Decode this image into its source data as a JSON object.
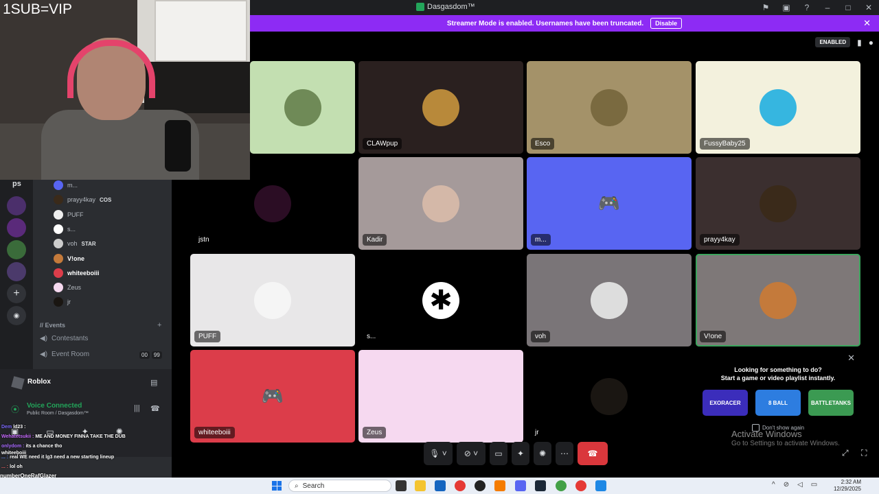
{
  "window": {
    "title": "Dasgasdom™"
  },
  "streamer": {
    "message": "Streamer Mode is enabled. Usernames have been truncated.",
    "disable_label": "Disable"
  },
  "call": {
    "enabled_badge": "ENABLED",
    "tiles": [
      {
        "name": "",
        "bg": "#c3dfb1",
        "avatar": "#6f8a57"
      },
      {
        "name": "CLAWpup",
        "bg": "#2a201f",
        "avatar": "#b8893a"
      },
      {
        "name": "Esco",
        "bg": "#a49269",
        "avatar": "#7a6a40"
      },
      {
        "name": "FussyBaby25",
        "bg": "#f3f1dd",
        "avatar": "#36b6e0"
      },
      {
        "name": "jstn",
        "bg": "#000000",
        "avatar": "#2b0d24"
      },
      {
        "name": "Kadir",
        "bg": "#a59a9a",
        "avatar": "#d4b8a8"
      },
      {
        "name": "m...",
        "bg": "#5865f2",
        "avatar": "#5865f2"
      },
      {
        "name": "prayy4kay",
        "bg": "#3b2f2f",
        "avatar": "#3a2a1a"
      },
      {
        "name": "PUFF",
        "bg": "#e8e7e8",
        "avatar": "#f5f5f5"
      },
      {
        "name": "s...",
        "bg": "#000000",
        "avatar": "#ffffff"
      },
      {
        "name": "voh",
        "bg": "#7a7578",
        "avatar": "#ddd"
      },
      {
        "name": "V!one",
        "bg": "#7e7878",
        "avatar": "#c47a3b"
      },
      {
        "name": "whiteeboiii",
        "bg": "#dc3d4a",
        "avatar": "#dc3d4a"
      },
      {
        "name": "Zeus",
        "bg": "#f6d9f0",
        "avatar": "#f6d9f0"
      },
      {
        "name": "jr",
        "bg": "#000000",
        "avatar": "#1a1612"
      }
    ],
    "activity": {
      "line1": "Looking for something to do?",
      "line2": "Start a game or video playlist instantly.",
      "games": [
        {
          "label": "EXORACER",
          "color": "#3b2dbb"
        },
        {
          "label": "8 BALL",
          "color": "#2d7de0"
        },
        {
          "label": "BATTLETANKS",
          "color": "#3b9a52"
        }
      ],
      "dont_show": "Don't show again"
    }
  },
  "activate": {
    "line1": "Activate Windows",
    "line2": "Go to Settings to activate Windows."
  },
  "webcam": {
    "overlay_text": "1SUB=VIP"
  },
  "sidebar": {
    "server_label": "ps",
    "voice_users": [
      {
        "name": "m...",
        "badge": "",
        "avatar": "#5865f2",
        "hl": false
      },
      {
        "name": "prayy4kay",
        "badge": "COS",
        "avatar": "#3a2a1a",
        "hl": false
      },
      {
        "name": "PUFF",
        "badge": "",
        "avatar": "#eeeeee",
        "hl": false
      },
      {
        "name": "s...",
        "badge": "",
        "avatar": "#ffffff",
        "hl": false
      },
      {
        "name": "voh",
        "badge": "STAR",
        "avatar": "#cccccc",
        "hl": false
      },
      {
        "name": "V!one",
        "badge": "",
        "avatar": "#c47a3b",
        "hl": true
      },
      {
        "name": "whiteeboiii",
        "badge": "",
        "avatar": "#dc3d4a",
        "hl": true
      },
      {
        "name": "Zeus",
        "badge": "",
        "avatar": "#f6d9f0",
        "hl": false
      },
      {
        "name": "jr",
        "badge": "",
        "avatar": "#1a1612",
        "hl": false
      }
    ],
    "category": "// Events",
    "channels": [
      "Contestants",
      "Event Room"
    ],
    "event_room_counts": [
      "00",
      "99"
    ],
    "activity_name": "Roblox",
    "voice_status": "Voice Connected",
    "voice_location": "Public Room / Dasgasdom™"
  },
  "chat": [
    {
      "user": "Dem",
      "text": "ld23 :"
    },
    {
      "user": "Wehatetsukii :",
      "text": "ME AND MONEY FINNA TAKE THE DUB"
    },
    {
      "user": "onlydom :",
      "text": "its a chance tho"
    },
    {
      "user": "whiteeboiii",
      "text": ""
    },
    {
      "user": "... :",
      "text": "real WE need it lg3 need a new starting lineup"
    },
    {
      "user": "... :",
      "text": "lol oh"
    }
  ],
  "bottom_names": [
    "numberOneRafGlazer",
    "numberOneRafGlazer"
  ],
  "taskbar": {
    "search": "Search",
    "time": "2:32 AM",
    "date": "12/29/2025"
  }
}
